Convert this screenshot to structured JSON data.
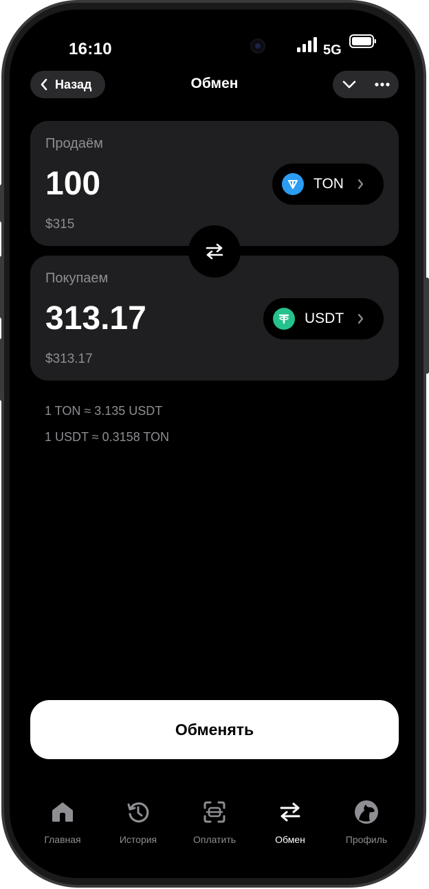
{
  "status_bar": {
    "time": "16:10",
    "network": "5G"
  },
  "header": {
    "back_label": "Назад",
    "title": "Обмен"
  },
  "sell": {
    "label": "Продаём",
    "amount": "100",
    "fiat": "$315",
    "token": "TON",
    "token_color": "#2b9cf2"
  },
  "buy": {
    "label": "Покупаем",
    "amount": "313.17",
    "fiat": "$313.17",
    "token": "USDT",
    "token_color": "#26c28e"
  },
  "rates": {
    "line1": "1 TON ≈ 3.135 USDT",
    "line2": "1 USDT ≈ 0.3158 TON"
  },
  "action": {
    "label": "Обменять"
  },
  "tabs": [
    {
      "label": "Главная",
      "icon": "home-icon"
    },
    {
      "label": "История",
      "icon": "history-icon"
    },
    {
      "label": "Оплатить",
      "icon": "scan-icon"
    },
    {
      "label": "Обмен",
      "icon": "swap-icon"
    },
    {
      "label": "Профиль",
      "icon": "profile-icon"
    }
  ],
  "active_tab": "Обмен",
  "colors": {
    "background": "#000000",
    "card": "#1f1f21",
    "muted_text": "#8e8e93",
    "button": "#ffffff"
  }
}
